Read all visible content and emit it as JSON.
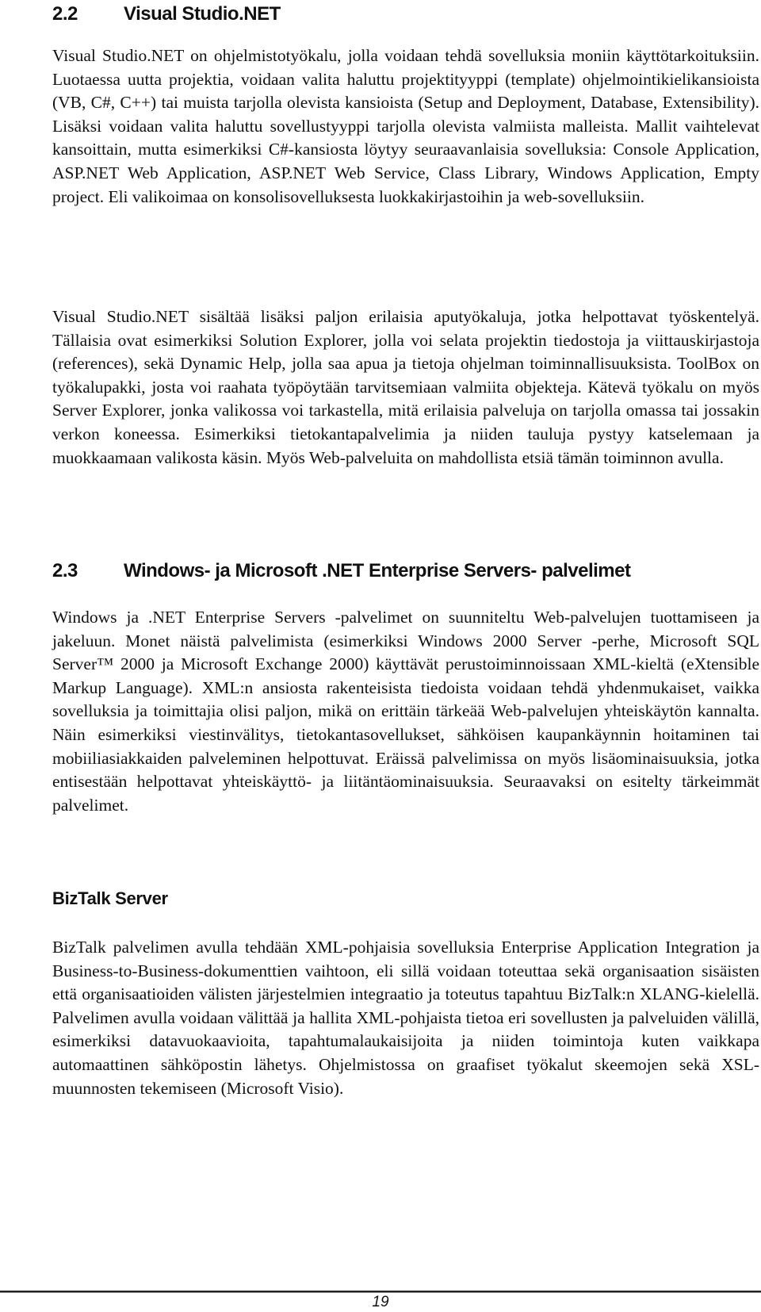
{
  "sections": [
    {
      "number": "2.2",
      "title": "Visual Studio.NET",
      "paragraphs": [
        "Visual Studio.NET on ohjelmistotyökalu, jolla voidaan tehdä sovelluksia moniin käyttötarkoituksiin. Luotaessa uutta projektia, voidaan valita haluttu projektityyppi (template) ohjelmointikielikansioista (VB, C#, C++) tai muista tarjolla olevista kansioista (Setup and Deployment, Database, Extensibility). Lisäksi voidaan valita haluttu sovellustyyppi tarjolla olevista valmiista malleista. Mallit vaihtelevat kansoittain, mutta esimerkiksi C#-kansiosta löytyy seuraavanlaisia sovelluksia: Console Application, ASP.NET Web Application, ASP.NET Web Service, Class Library, Windows Application, Empty project. Eli valikoimaa on konsolisovelluksesta luokkakirjastoihin ja web-sovelluksiin.",
        "Visual Studio.NET sisältää lisäksi paljon erilaisia aputyökaluja, jotka helpottavat työskentelyä. Tällaisia ovat esimerkiksi Solution Explorer, jolla  voi selata projektin tiedostoja ja viittauskirjastoja (references), sekä Dynamic Help, jolla saa apua ja tietoja ohjelman toiminnallisuuksista. ToolBox on työkalupakki, josta voi raahata työpöytään tarvitsemiaan valmiita objekteja. Kätevä työkalu on myös Server Explorer, jonka valikossa voi tarkastella, mitä erilaisia palveluja on tarjolla omassa tai jossakin verkon koneessa. Esimerkiksi tietokantapalvelimia ja niiden tauluja pystyy katselemaan ja muokkaamaan valikosta käsin. Myös Web-palveluita on mahdollista etsiä tämän toiminnon avulla."
      ]
    },
    {
      "number": "2.3",
      "title": "Windows- ja Microsoft .NET Enterprise Servers- palvelimet",
      "paragraphs": [
        "Windows ja .NET Enterprise Servers -palvelimet on suunniteltu Web-palvelujen tuottamiseen ja jakeluun. Monet näistä palvelimista (esimerkiksi Windows 2000 Server -perhe, Microsoft SQL Server™ 2000 ja Microsoft Exchange 2000) käyttävät perustoiminnoissaan XML-kieltä (eXtensible Markup Language). XML:n ansiosta rakenteisista tiedoista voidaan tehdä yhdenmukaiset, vaikka sovelluksia ja toimittajia olisi paljon, mikä on erittäin tärkeää Web-palvelujen yhteiskäytön kannalta. Näin esimerkiksi viestinvälitys, tietokantasovellukset, sähköisen kaupankäynnin hoitaminen tai mobiiliasiakkaiden palveleminen helpottuvat. Eräissä palvelimissa on myös lisäominaisuuksia, jotka entisestään helpottavat yhteiskäyttö- ja liitäntäominaisuuksia. Seuraavaksi on esitelty tärkeimmät palvelimet."
      ],
      "subsections": [
        {
          "title": "BizTalk Server",
          "paragraphs": [
            "BizTalk palvelimen avulla tehdään XML-pohjaisia sovelluksia Enterprise Application Integration ja Business-to-Business-dokumenttien vaihtoon, eli sillä voidaan toteuttaa sekä organisaation sisäisten että organisaatioiden välisten järjestelmien integraatio ja toteutus tapahtuu BizTalk:n XLANG-kielellä. Palvelimen avulla voidaan välittää ja hallita XML-pohjaista tietoa eri sovellusten ja palveluiden välillä, esimerkiksi datavuokaavioita, tapahtumalaukaisijoita ja niiden toimintoja kuten vaikkapa automaattinen sähköpostin lähetys. Ohjelmistossa on graafiset työkalut skeemojen sekä XSL-muunnosten tekemiseen (Microsoft Visio)."
          ]
        }
      ]
    }
  ],
  "footer": {
    "page_number": "19"
  }
}
